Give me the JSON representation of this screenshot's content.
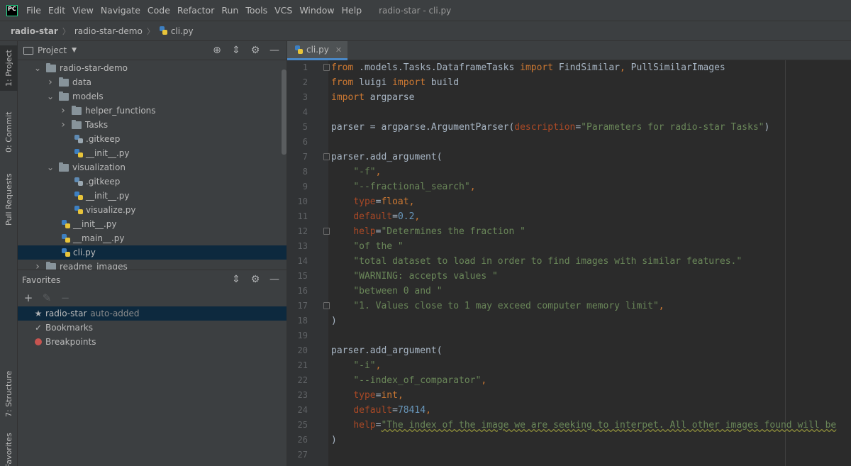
{
  "app": {
    "logo_text": "PC",
    "window_title": "radio-star - cli.py"
  },
  "menu": [
    "File",
    "Edit",
    "View",
    "Navigate",
    "Code",
    "Refactor",
    "Run",
    "Tools",
    "VCS",
    "Window",
    "Help"
  ],
  "breadcrumb": [
    "radio-star",
    "radio-star-demo",
    "cli.py"
  ],
  "left_strip": [
    "1: Project",
    "0: Commit",
    "Pull Requests",
    "7: Structure",
    "Favorites"
  ],
  "project": {
    "title": "Project",
    "tree": [
      {
        "label": "radio-star-demo",
        "type": "folder",
        "expanded": true,
        "depth": 0
      },
      {
        "label": "data",
        "type": "folder",
        "expanded": false,
        "depth": 1
      },
      {
        "label": "models",
        "type": "folder",
        "expanded": true,
        "depth": 1
      },
      {
        "label": "helper_functions",
        "type": "folder",
        "expanded": false,
        "depth": 2
      },
      {
        "label": "Tasks",
        "type": "folder",
        "expanded": false,
        "depth": 2
      },
      {
        "label": ".gitkeep",
        "type": "file-plain",
        "depth": 2
      },
      {
        "label": "__init__.py",
        "type": "file-py",
        "depth": 2
      },
      {
        "label": "visualization",
        "type": "folder",
        "expanded": true,
        "depth": 1
      },
      {
        "label": ".gitkeep",
        "type": "file-plain",
        "depth": 2
      },
      {
        "label": "__init__.py",
        "type": "file-py",
        "depth": 2
      },
      {
        "label": "visualize.py",
        "type": "file-py",
        "depth": 2
      },
      {
        "label": "__init__.py",
        "type": "file-py",
        "depth": 1
      },
      {
        "label": "__main__.py",
        "type": "file-py",
        "depth": 1
      },
      {
        "label": "cli.py",
        "type": "file-py",
        "depth": 1,
        "selected": true
      },
      {
        "label": "readme_images",
        "type": "folder",
        "expanded": false,
        "depth": 0
      }
    ]
  },
  "favorites": {
    "title": "Favorites",
    "items": [
      {
        "icon": "star-icon",
        "label": "radio-star",
        "note": "auto-added",
        "selected": true
      },
      {
        "icon": "check-icon",
        "label": "Bookmarks",
        "note": ""
      },
      {
        "icon": "breakpoint-icon",
        "label": "Breakpoints",
        "note": ""
      }
    ]
  },
  "editor": {
    "tab_label": "cli.py",
    "lines": [
      [
        [
          "kw",
          "from"
        ],
        [
          "t",
          " .models.Tasks.DataframeTasks "
        ],
        [
          "kw",
          "import"
        ],
        [
          "t",
          " FindSimilar"
        ],
        [
          "kw",
          ","
        ],
        [
          "t",
          " PullSimilarImages"
        ]
      ],
      [
        [
          "kw",
          "from"
        ],
        [
          "t",
          " luigi "
        ],
        [
          "kw",
          "import"
        ],
        [
          "t",
          " build"
        ]
      ],
      [
        [
          "kw",
          "import"
        ],
        [
          "t",
          " argparse"
        ]
      ],
      [],
      [
        [
          "t",
          "parser = argparse.ArgumentParser("
        ],
        [
          "param",
          "description"
        ],
        [
          "t",
          "="
        ],
        [
          "str",
          "\"Parameters for radio-star Tasks\""
        ],
        [
          "t",
          ")"
        ]
      ],
      [],
      [
        [
          "t",
          "parser.add_argument("
        ]
      ],
      [
        [
          "t",
          "    "
        ],
        [
          "str",
          "\"-f\""
        ],
        [
          "kw",
          ","
        ]
      ],
      [
        [
          "t",
          "    "
        ],
        [
          "str",
          "\"--fractional_search\""
        ],
        [
          "kw",
          ","
        ]
      ],
      [
        [
          "t",
          "    "
        ],
        [
          "param",
          "type"
        ],
        [
          "t",
          "="
        ],
        [
          "kw",
          "float"
        ],
        [
          "kw",
          ","
        ]
      ],
      [
        [
          "t",
          "    "
        ],
        [
          "param",
          "default"
        ],
        [
          "t",
          "="
        ],
        [
          "num",
          "0.2"
        ],
        [
          "kw",
          ","
        ]
      ],
      [
        [
          "t",
          "    "
        ],
        [
          "param",
          "help"
        ],
        [
          "t",
          "="
        ],
        [
          "str",
          "\"Determines the fraction \""
        ]
      ],
      [
        [
          "t",
          "    "
        ],
        [
          "str",
          "\"of the \""
        ]
      ],
      [
        [
          "t",
          "    "
        ],
        [
          "str",
          "\"total dataset to load in order to find images with similar features.\""
        ]
      ],
      [
        [
          "t",
          "    "
        ],
        [
          "str",
          "\"WARNING: accepts values \""
        ]
      ],
      [
        [
          "t",
          "    "
        ],
        [
          "str",
          "\"between 0 and \""
        ]
      ],
      [
        [
          "t",
          "    "
        ],
        [
          "str",
          "\"1. Values close to 1 may exceed computer memory limit\""
        ],
        [
          "kw",
          ","
        ]
      ],
      [
        [
          "t",
          ")"
        ]
      ],
      [],
      [
        [
          "t",
          "parser.add_argument("
        ]
      ],
      [
        [
          "t",
          "    "
        ],
        [
          "str",
          "\"-i\""
        ],
        [
          "kw",
          ","
        ]
      ],
      [
        [
          "t",
          "    "
        ],
        [
          "str",
          "\"--index_of_comparator\""
        ],
        [
          "kw",
          ","
        ]
      ],
      [
        [
          "t",
          "    "
        ],
        [
          "param",
          "type"
        ],
        [
          "t",
          "="
        ],
        [
          "kw",
          "int"
        ],
        [
          "kw",
          ","
        ]
      ],
      [
        [
          "t",
          "    "
        ],
        [
          "param",
          "default"
        ],
        [
          "t",
          "="
        ],
        [
          "num",
          "78414"
        ],
        [
          "kw",
          ","
        ]
      ],
      [
        [
          "t",
          "    "
        ],
        [
          "param",
          "help"
        ],
        [
          "t",
          "="
        ],
        [
          "sq",
          "\"The index of the image we are seeking to interpet. All other images found will be"
        ]
      ],
      [
        [
          "t",
          ")"
        ]
      ],
      []
    ],
    "fold_lines": [
      1,
      7,
      12,
      17
    ]
  }
}
